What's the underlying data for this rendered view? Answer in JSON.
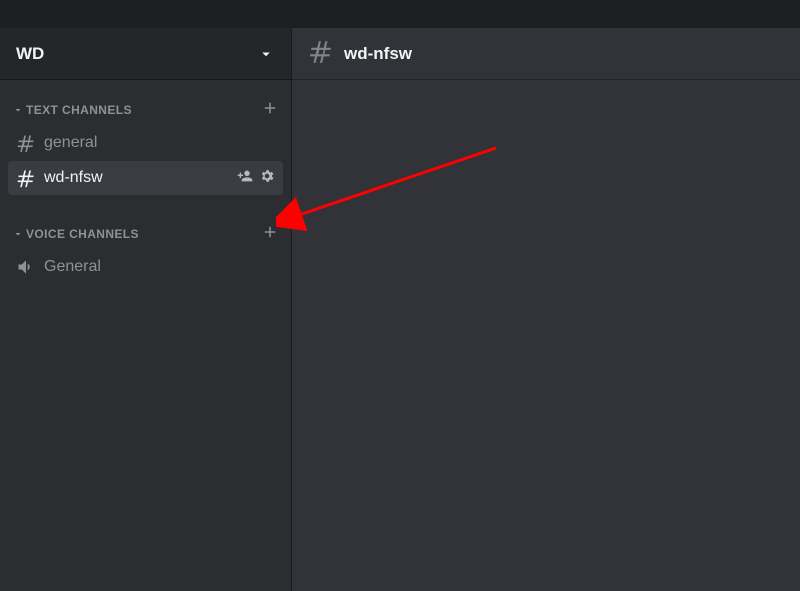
{
  "server": {
    "name": "WD"
  },
  "categories": {
    "text": {
      "label": "TEXT CHANNELS",
      "channels": [
        {
          "name": "general"
        },
        {
          "name": "wd-nfsw"
        }
      ]
    },
    "voice": {
      "label": "VOICE CHANNELS",
      "channels": [
        {
          "name": "General"
        }
      ]
    }
  },
  "current_channel": {
    "name": "wd-nfsw"
  }
}
